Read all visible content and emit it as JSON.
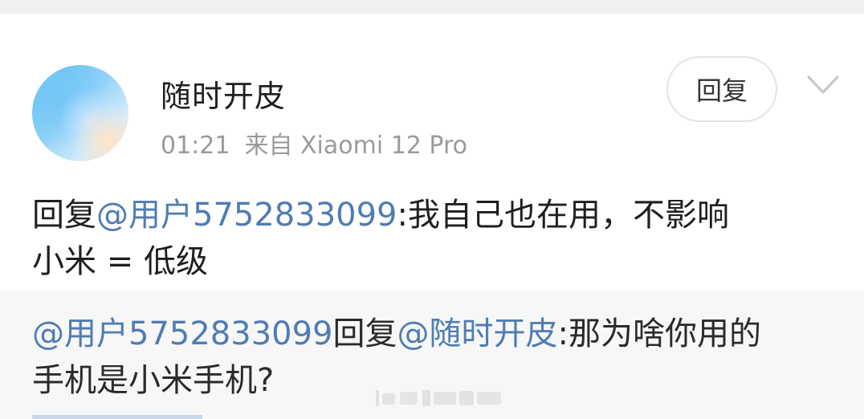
{
  "post": {
    "username": "随时开皮",
    "time": "01:21",
    "source": "来自 Xiaomi 12 Pro",
    "reply_button": "回复"
  },
  "comment": {
    "prefix": "回复",
    "mention": "@用户5752833099",
    "text_line1": ":我自己也在用，不影响",
    "text_line2": "小米 = 低级"
  },
  "quoted": {
    "mention_user": "@用户5752833099",
    "reply_word": "回复",
    "mention_target": "@随时开皮",
    "text_line1": ":那为啥你用的",
    "text_line2": "手机是小米手机?"
  },
  "colors": {
    "mention": "#4f7cb3",
    "text": "#1f1f1f",
    "meta": "#9a9a9a",
    "quote_bg": "#f7f7f7"
  },
  "icons": {
    "chevron": "chevron-down-icon",
    "avatar": "avatar-gradient"
  }
}
